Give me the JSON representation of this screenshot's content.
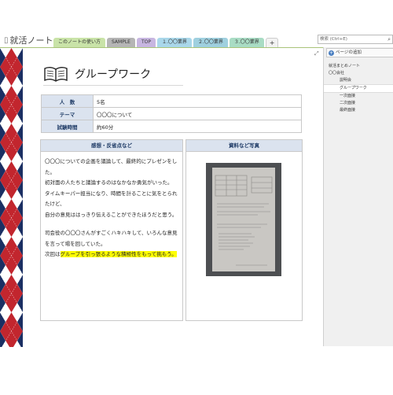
{
  "notebook": {
    "title": "就活ノート"
  },
  "tabs": [
    {
      "label": "このノートの使い方",
      "color": "#c9e3a8"
    },
    {
      "label": "SAMPLE",
      "color": "#b5b5b5"
    },
    {
      "label": "TOP",
      "color": "#c7b6e0"
    },
    {
      "label": "１.〇〇業界",
      "color": "#a9d7ea"
    },
    {
      "label": "２.〇〇業界",
      "color": "#9fd0df"
    },
    {
      "label": "３.〇〇業界",
      "color": "#a9dcc4"
    }
  ],
  "add_tab_label": "+",
  "search": {
    "placeholder": "検索 (Ctrl+E)"
  },
  "page": {
    "title": "グループワーク",
    "info": [
      {
        "key": "人　数",
        "value": "5名"
      },
      {
        "key": "テーマ",
        "value": "〇〇〇について"
      },
      {
        "key": "試験時間",
        "value": "約60分"
      }
    ],
    "impressions": {
      "header": "感想・反省点など",
      "lines": [
        "〇〇〇についての企画を議論して、最終的にプレゼンをした。",
        "初対面の人たちと議論するのはなかなか勇気がいった。",
        "タイムキーパー担当になり、時間を計ることに気をとられたけど、",
        "自分の意見ははっきり伝えることができたほうだと思う。",
        "",
        "司会役の〇〇〇さんがすごくハキハキして、いろんな意見を言って場を回していた。"
      ],
      "last_prefix": "次回は",
      "last_highlight": "グループを引っ張るような積極性をもって挑もう。"
    },
    "photos": {
      "header": "資料など写真"
    }
  },
  "right_pane": {
    "add_page_label": "ページの追加",
    "pages": [
      {
        "label": "就活まとめノート",
        "level": 0,
        "selected": false
      },
      {
        "label": "〇〇会社",
        "level": 0,
        "selected": false
      },
      {
        "label": "説明会",
        "level": 1,
        "selected": false
      },
      {
        "label": "グループワーク",
        "level": 1,
        "selected": true
      },
      {
        "label": "一次面接",
        "level": 1,
        "selected": false
      },
      {
        "label": "二次面接",
        "level": 1,
        "selected": false
      },
      {
        "label": "最終面接",
        "level": 1,
        "selected": false
      }
    ]
  },
  "colors": {
    "accent_blue": "#dbe3ef",
    "argyle_red": "#c2262e",
    "argyle_navy": "#1b2f63",
    "highlight": "#ffff00"
  }
}
